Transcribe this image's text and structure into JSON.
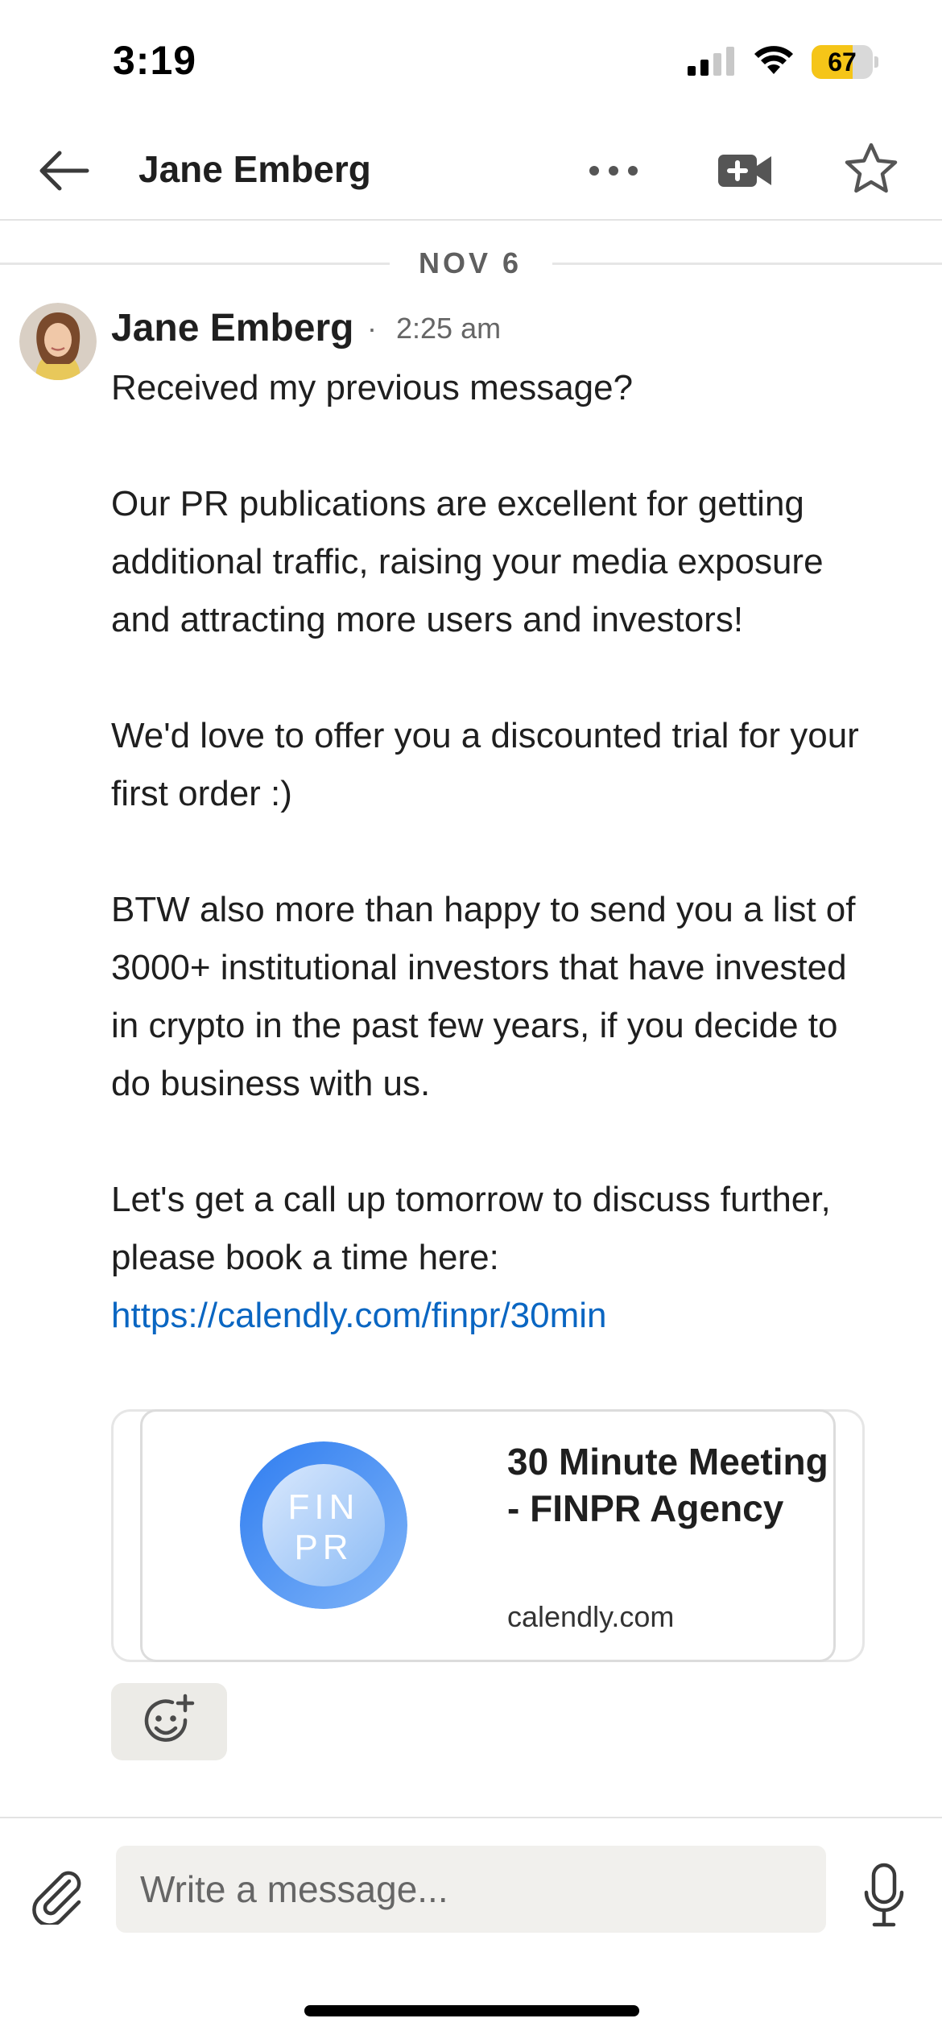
{
  "status_bar": {
    "time": "3:19",
    "battery_percent": 67,
    "battery_label": "67",
    "signal_icon": "cellular-signal-icon",
    "wifi_icon": "wifi-icon"
  },
  "header": {
    "title": "Jane Emberg",
    "back_icon": "arrow-left-icon",
    "more_icon": "more-dots-icon",
    "video_icon": "video-call-icon",
    "star_icon": "star-outline-icon"
  },
  "conversation": {
    "date_divider": "NOV 6",
    "message": {
      "sender": "Jane Emberg",
      "separator": "·",
      "time": "2:25 am",
      "paragraphs": [
        "Received my previous message?",
        "Our PR publications are excellent for getting additional traffic, raising your media exposure and attracting more users and investors!",
        "We'd love to offer you a discounted trial for your first order :)",
        "BTW also more than happy to send you a list of 3000+ institutional investors that have invested in crypto in the past few years, if you decide to do business with us."
      ],
      "last_paragraph_text": "Let's get a call up tomorrow to discuss further, please book a time here: ",
      "link": "https://calendly.com/finpr/30min",
      "preview": {
        "logo_text_line1": "FIN",
        "logo_text_line2": "PR",
        "title": "30 Minute Meeting - FINPR Agency",
        "domain": "calendly.com"
      },
      "reaction_icon": "add-reaction-icon"
    }
  },
  "composer": {
    "placeholder": "Write a message...",
    "value": "",
    "attach_icon": "paperclip-icon",
    "mic_icon": "microphone-icon"
  },
  "colors": {
    "link": "#0a66c2",
    "battery_fill": "#f5c518",
    "logo_blue": "#4a90f0",
    "input_bg": "#f1f0ed"
  }
}
